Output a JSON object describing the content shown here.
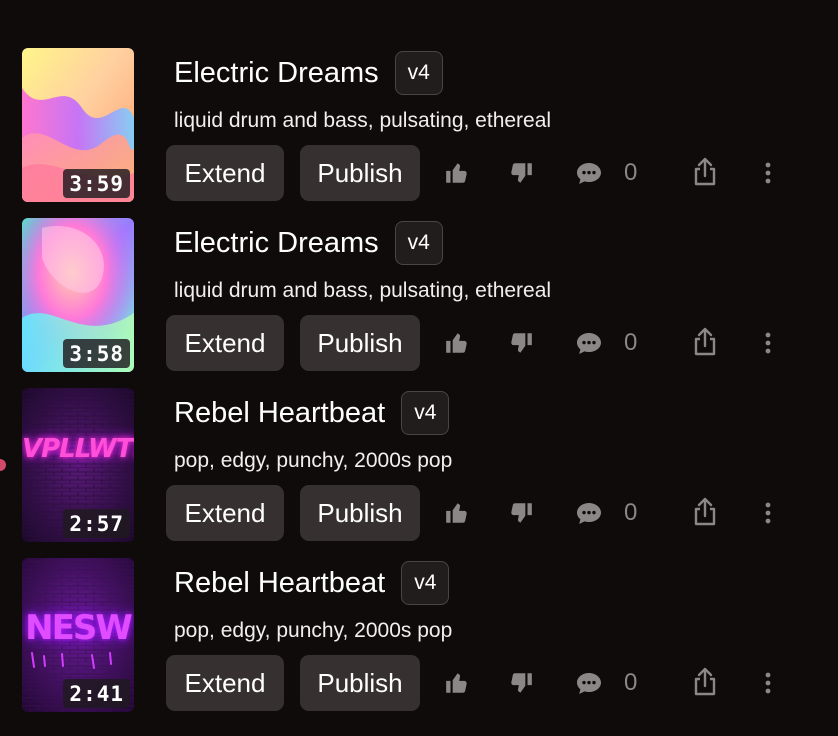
{
  "songs": [
    {
      "title": "Electric Dreams",
      "version": "v4",
      "tags": "liquid drum and bass, pulsating, ethereal",
      "duration": "3:59",
      "extend_label": "Extend",
      "publish_label": "Publish",
      "comment_count": "0",
      "cover_art": "pastel-liquid-gradient"
    },
    {
      "title": "Electric Dreams",
      "version": "v4",
      "tags": "liquid drum and bass, pulsating, ethereal",
      "duration": "3:58",
      "extend_label": "Extend",
      "publish_label": "Publish",
      "comment_count": "0",
      "cover_art": "pastel-liquid-gradient-2"
    },
    {
      "title": "Rebel Heartbeat",
      "version": "v4",
      "tags": "pop, edgy, punchy, 2000s pop",
      "duration": "2:57",
      "extend_label": "Extend",
      "publish_label": "Publish",
      "comment_count": "0",
      "cover_art": "neon-graffiti-brick-wall",
      "art_text": "VPLLWT!"
    },
    {
      "title": "Rebel Heartbeat",
      "version": "v4",
      "tags": "pop, edgy, punchy, 2000s pop",
      "duration": "2:41",
      "extend_label": "Extend",
      "publish_label": "Publish",
      "comment_count": "0",
      "cover_art": "neon-graffiti-brick-wall-2",
      "art_text": "NESW"
    }
  ],
  "icons": {
    "like": "thumbs-up-icon",
    "dislike": "thumbs-down-icon",
    "comment": "comment-icon",
    "share": "share-icon",
    "more": "more-vertical-icon"
  },
  "colors": {
    "background": "#0f0b0b",
    "button_bg": "#363030",
    "icon_gray": "#8c8787",
    "active_indicator": "#d24a6a"
  }
}
